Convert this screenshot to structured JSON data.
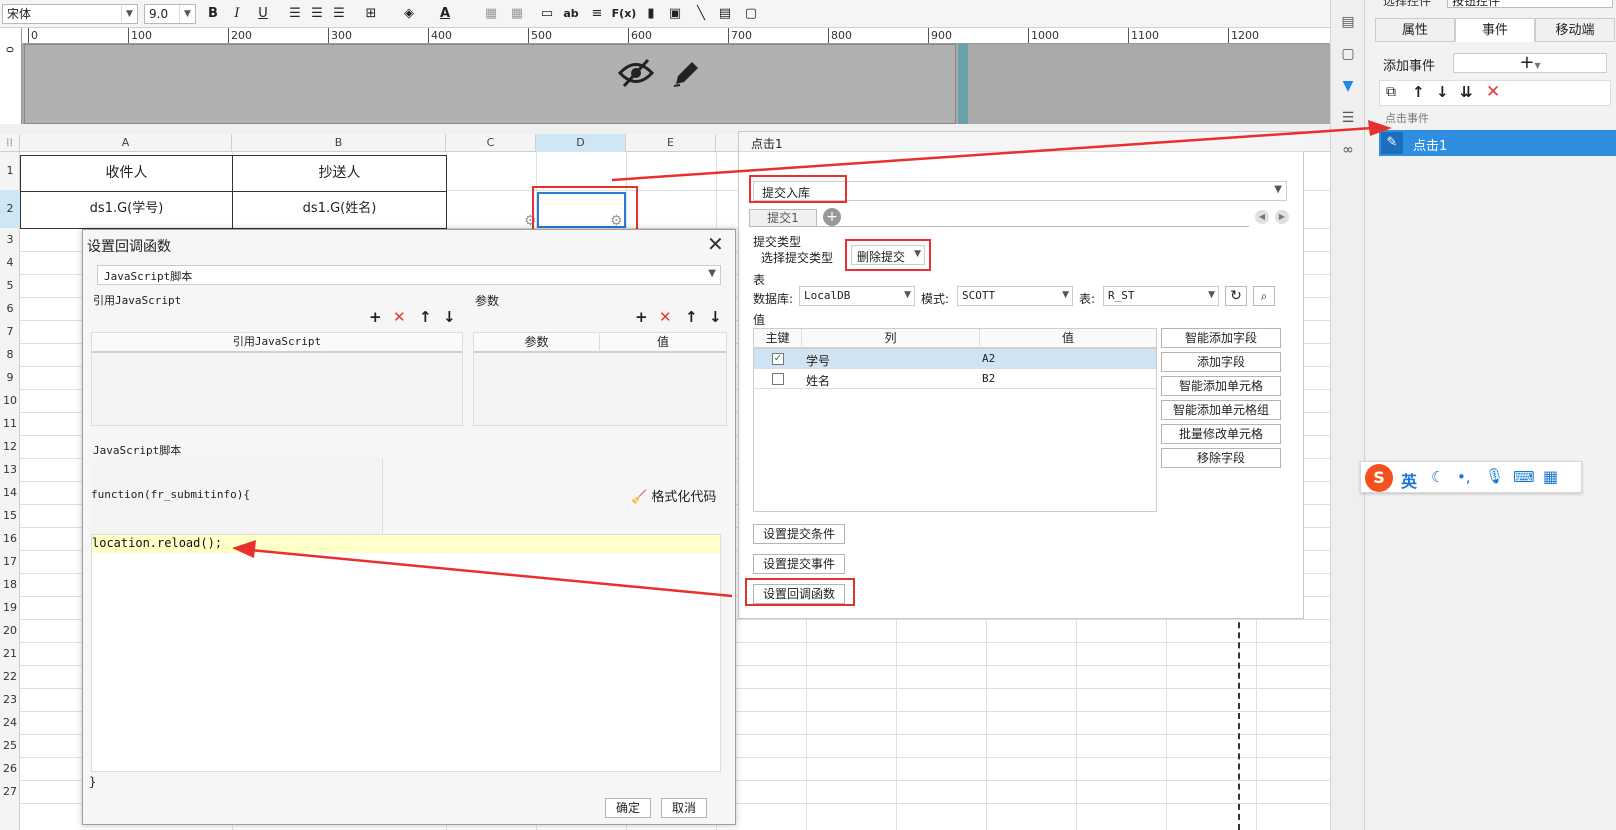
{
  "toolbar": {
    "font_family": "宋体",
    "font_size": "9.0",
    "bold": "B",
    "italic": "I",
    "underline": "U",
    "fx": "F(x)",
    "ab": "ab"
  },
  "ruler": {
    "ticks": [
      "0",
      "100",
      "200",
      "300",
      "400",
      "500",
      "600",
      "700",
      "800",
      "900",
      "1000",
      "1100",
      "1200"
    ],
    "vertical_label": "0"
  },
  "sheet": {
    "columns": [
      "A",
      "B",
      "C",
      "D",
      "E"
    ],
    "rows": [
      "1",
      "2",
      "3",
      "4",
      "5",
      "6",
      "7",
      "8",
      "9",
      "10",
      "11",
      "12",
      "13",
      "14",
      "15",
      "16",
      "17",
      "18",
      "19",
      "20",
      "21",
      "22",
      "23",
      "24",
      "25",
      "26",
      "27"
    ],
    "cells": {
      "a1": "收件人",
      "b1": "抄送人",
      "a2": "ds1.G(学号)",
      "b2": "ds1.G(姓名)"
    }
  },
  "right_panel": {
    "top_label_left": "选择控件",
    "top_label_right": "按钮控件",
    "tabs": [
      "属性",
      "事件",
      "移动端"
    ],
    "add_event_label": "添加事件",
    "add_symbol": "+",
    "section_label": "点击事件",
    "selected_event": "点击1"
  },
  "event_dialog": {
    "title": "点击1",
    "event_type": "提交入库",
    "sub_tab": "提交1",
    "submit_type_section": "提交类型",
    "submit_type_label": "选择提交类型",
    "submit_type_value": "删除提交",
    "table_section": "表",
    "db_label": "数据库:",
    "db_value": "LocalDB",
    "schema_label": "模式:",
    "schema_value": "SCOTT",
    "table_label": "表:",
    "table_value": "R_ST",
    "value_section": "值",
    "grid_headers": [
      "主键",
      "列",
      "值"
    ],
    "rows": [
      {
        "key_checked": true,
        "column": "学号",
        "value": "A2"
      },
      {
        "key_checked": false,
        "column": "姓名",
        "value": "B2"
      }
    ],
    "side_buttons": [
      "智能添加字段",
      "添加字段",
      "智能添加单元格",
      "智能添加单元格组",
      "批量修改单元格",
      "移除字段"
    ],
    "bottom_buttons": [
      "设置提交条件",
      "设置提交事件",
      "设置回调函数"
    ]
  },
  "callback_dialog": {
    "title": "设置回调函数",
    "type_value": "JavaScript脚本",
    "ref_js_section": "引用JavaScript",
    "params_section": "参数",
    "ref_js_header": "引用JavaScript",
    "param_headers": [
      "参数",
      "值"
    ],
    "script_section": "JavaScript脚本",
    "function_sig": "function(fr_submitinfo){",
    "code_line": "location.reload();",
    "closing_brace": "}",
    "format_code": "格式化代码",
    "ok": "确定",
    "cancel": "取消"
  },
  "ime": {
    "lang": "英",
    "logo": "S"
  }
}
